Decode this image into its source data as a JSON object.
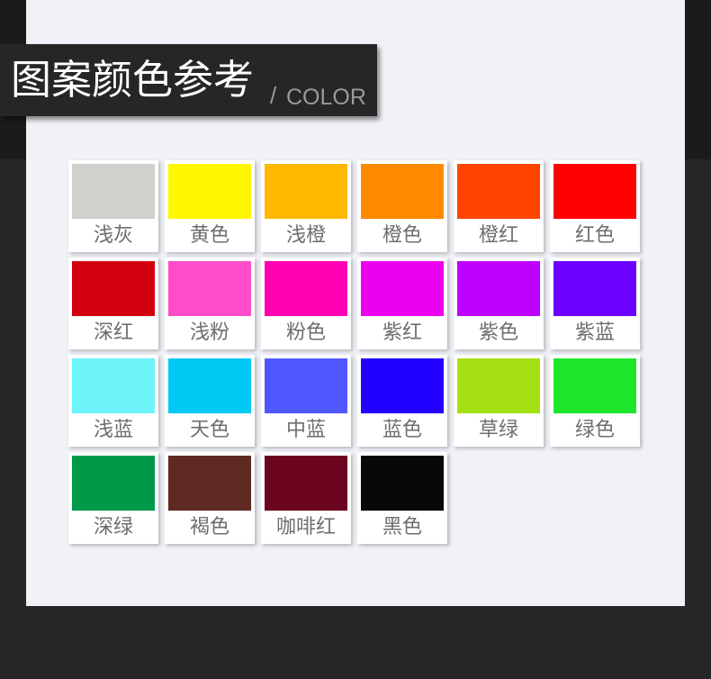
{
  "header": {
    "title": "图案颜色参考",
    "slash": "/",
    "subtitle": "COLOR"
  },
  "colors": [
    {
      "label": "浅灰",
      "hex": "#d0d0cc"
    },
    {
      "label": "黄色",
      "hex": "#fff700"
    },
    {
      "label": "浅橙",
      "hex": "#ffb700"
    },
    {
      "label": "橙色",
      "hex": "#ff8a00"
    },
    {
      "label": "橙红",
      "hex": "#ff4400"
    },
    {
      "label": "红色",
      "hex": "#ff0000"
    },
    {
      "label": "深红",
      "hex": "#d2000e"
    },
    {
      "label": "浅粉",
      "hex": "#ff4cc8"
    },
    {
      "label": "粉色",
      "hex": "#ff00b2"
    },
    {
      "label": "紫红",
      "hex": "#ec00f0"
    },
    {
      "label": "紫色",
      "hex": "#be00ff"
    },
    {
      "label": "紫蓝",
      "hex": "#6b00ff"
    },
    {
      "label": "浅蓝",
      "hex": "#6df5fa"
    },
    {
      "label": "天色",
      "hex": "#00c8f5"
    },
    {
      "label": "中蓝",
      "hex": "#5157ff"
    },
    {
      "label": "蓝色",
      "hex": "#2200ff"
    },
    {
      "label": "草绿",
      "hex": "#a5e012"
    },
    {
      "label": "绿色",
      "hex": "#1ee62c"
    },
    {
      "label": "深绿",
      "hex": "#00994a"
    },
    {
      "label": "褐色",
      "hex": "#5e2a22"
    },
    {
      "label": "咖啡红",
      "hex": "#6b041e"
    },
    {
      "label": "黑色",
      "hex": "#080808"
    }
  ]
}
